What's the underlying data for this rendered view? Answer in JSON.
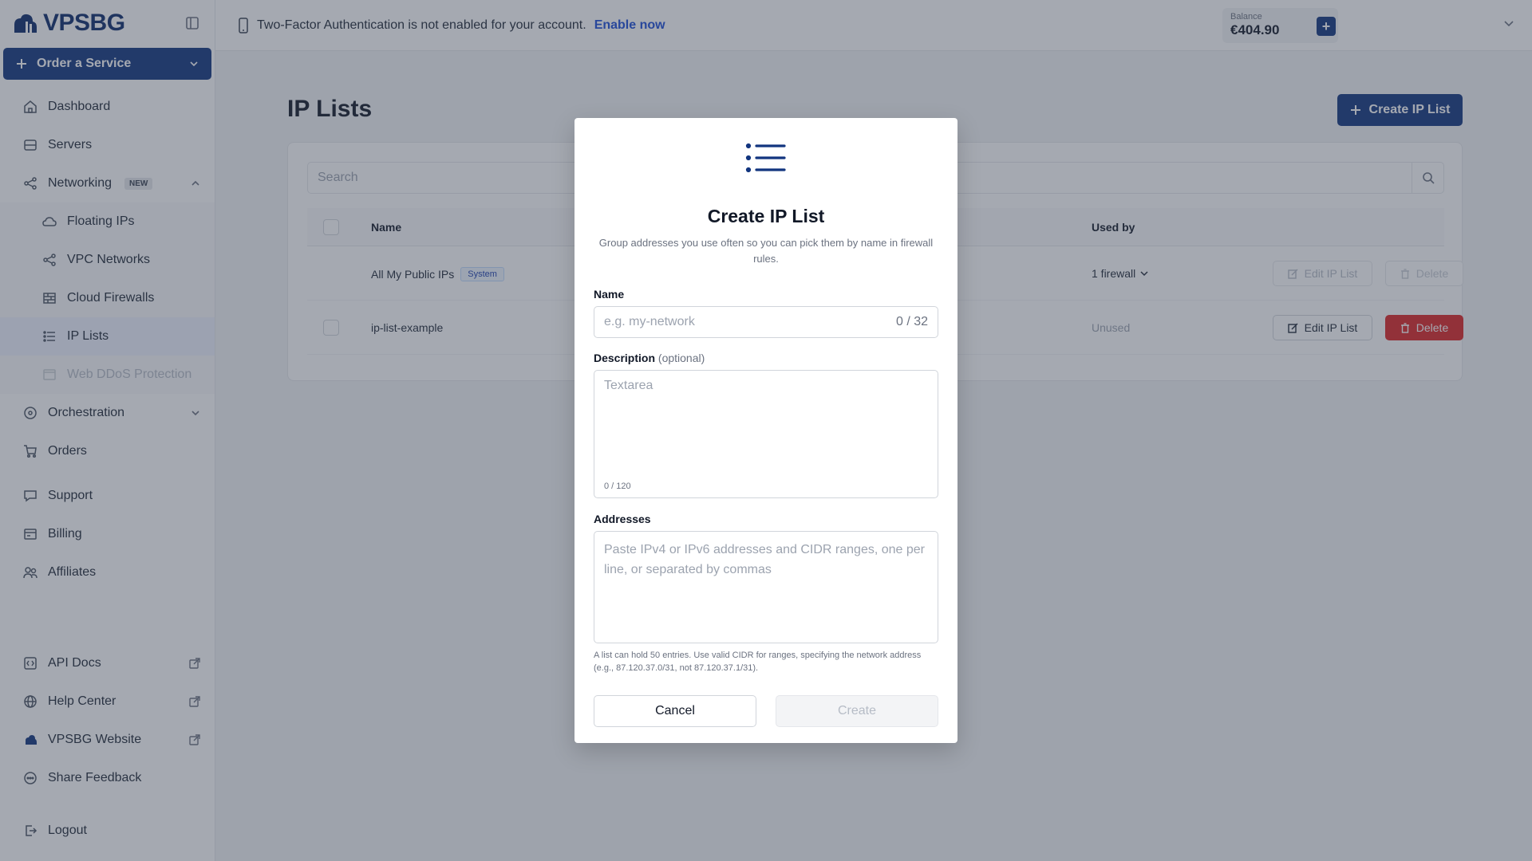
{
  "brand": {
    "name": "VPSBG"
  },
  "sidebar": {
    "order_label": "Order a Service",
    "items": [
      {
        "label": "Dashboard",
        "icon": "home-icon"
      },
      {
        "label": "Servers",
        "icon": "server-icon"
      },
      {
        "label": "Networking",
        "icon": "share-icon",
        "badge": "NEW"
      },
      {
        "label": "Floating IPs",
        "icon": "cloud-icon"
      },
      {
        "label": "VPC Networks",
        "icon": "network-icon"
      },
      {
        "label": "Cloud Firewalls",
        "icon": "firewall-icon"
      },
      {
        "label": "IP Lists",
        "icon": "list-icon"
      },
      {
        "label": "Web DDoS Protection",
        "icon": "shield-window-icon"
      },
      {
        "label": "Orchestration",
        "icon": "orchestration-icon"
      },
      {
        "label": "Orders",
        "icon": "cart-icon"
      },
      {
        "label": "Support",
        "icon": "chat-icon"
      },
      {
        "label": "Billing",
        "icon": "billing-icon"
      },
      {
        "label": "Affiliates",
        "icon": "users-icon"
      },
      {
        "label": "API Docs",
        "icon": "code-icon"
      },
      {
        "label": "Help Center",
        "icon": "globe-icon"
      },
      {
        "label": "VPSBG Website",
        "icon": "cloud-icon"
      },
      {
        "label": "Share Feedback",
        "icon": "feedback-icon"
      },
      {
        "label": "Logout",
        "icon": "logout-icon"
      }
    ]
  },
  "topbar": {
    "tfa_message": "Two-Factor Authentication is not enabled for your account.",
    "tfa_link": "Enable now",
    "balance_label": "Balance",
    "balance_value": "€404.90"
  },
  "main": {
    "title": "IP Lists",
    "create_label": "Create IP List",
    "search_placeholder": "Search",
    "columns": {
      "name": "Name",
      "used_by": "Used by"
    },
    "rows": [
      {
        "name": "All My Public IPs",
        "badge": "System",
        "used_by": "1 firewall",
        "edit": "Edit IP List",
        "delete": "Delete"
      },
      {
        "name": "ip-list-example",
        "used_by": "Unused",
        "edit": "Edit IP List",
        "delete": "Delete"
      }
    ]
  },
  "modal": {
    "title": "Create IP List",
    "description": "Group addresses you use often so you can pick them by name in firewall rules.",
    "name_label": "Name",
    "name_placeholder": "e.g. my-network",
    "name_count": "0 / 32",
    "desc_label": "Description",
    "desc_optional": "(optional)",
    "desc_placeholder": "Textarea",
    "desc_count": "0 / 120",
    "addr_label": "Addresses",
    "addr_placeholder": "Paste IPv4 or IPv6 addresses and CIDR ranges, one per line, or separated by commas",
    "hint": "A list can hold 50 entries. Use valid CIDR for ranges, specifying the network address (e.g., 87.120.37.0/31, not 87.120.37.1/31).",
    "cancel_label": "Cancel",
    "create_label": "Create"
  },
  "colors": {
    "brand": "#12357f",
    "danger": "#dc2626",
    "link": "#1d4ed8"
  }
}
